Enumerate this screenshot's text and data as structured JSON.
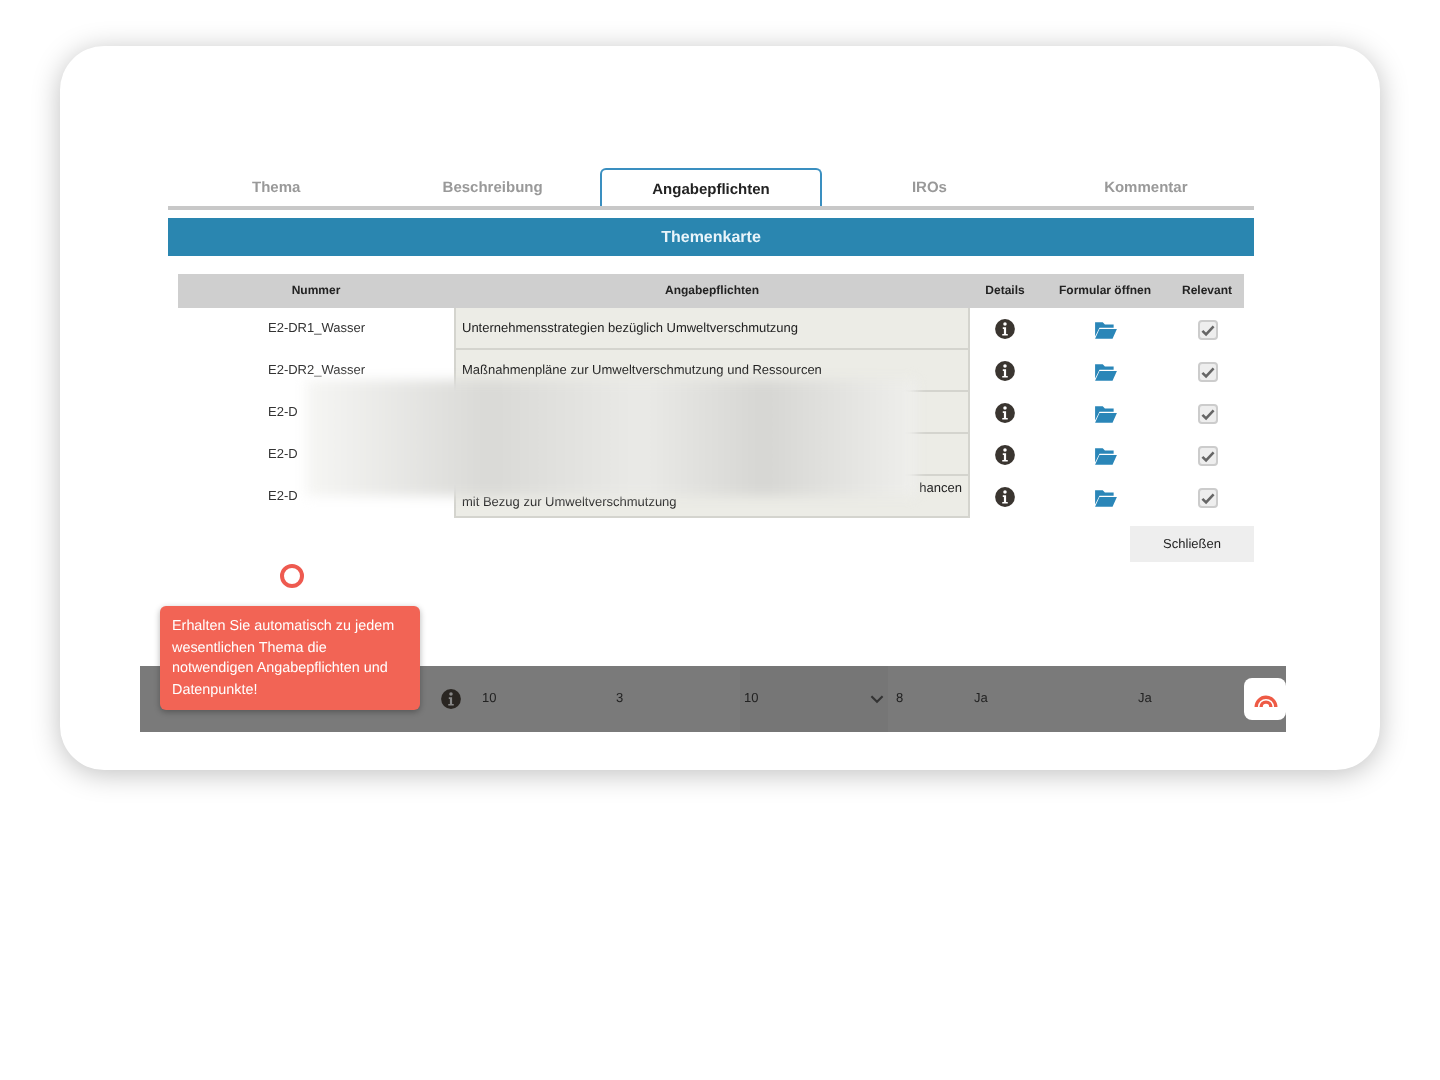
{
  "tabs": [
    {
      "label": "Thema",
      "selected": false
    },
    {
      "label": "Beschreibung",
      "selected": false
    },
    {
      "label": "Angabepflichten",
      "selected": true
    },
    {
      "label": "IROs",
      "selected": false
    },
    {
      "label": "Kommentar",
      "selected": false
    }
  ],
  "banner": "Themenkarte",
  "table": {
    "columns": [
      "Nummer",
      "Angabepflichten",
      "Details",
      "Formular öffnen",
      "Relevant"
    ],
    "rows": [
      {
        "number": "E2-DR1_Wasser",
        "text": [
          "Unternehmensstrategien bezüglich Umweltverschmutzung"
        ],
        "relevant": true
      },
      {
        "number": "E2-DR2_Wasser",
        "text": [
          "Maßnahmenpläne zur Umweltverschmutzung und Ressourcen"
        ],
        "relevant": true
      },
      {
        "number": "E2-D",
        "text": [],
        "relevant": true
      },
      {
        "number": "E2-D",
        "text": [],
        "relevant": true
      },
      {
        "number": "E2-D",
        "text": [
          "hancen",
          "mit Bezug zur Umweltverschmutzung"
        ],
        "relevant": true
      }
    ]
  },
  "close_button": "Schließen",
  "tooltip": "Erhalten Sie automatisch zu jedem wesentlichen Thema die notwendigen Angabepflichten und Datenpunkte!",
  "bottom_row": [
    {
      "kind": "text",
      "value": "10"
    },
    {
      "kind": "text",
      "value": "3"
    },
    {
      "kind": "dropdown",
      "value": "10"
    },
    {
      "kind": "text",
      "value": "8"
    },
    {
      "kind": "text",
      "value": "Ja"
    },
    {
      "kind": "text",
      "value": "Ja"
    }
  ]
}
